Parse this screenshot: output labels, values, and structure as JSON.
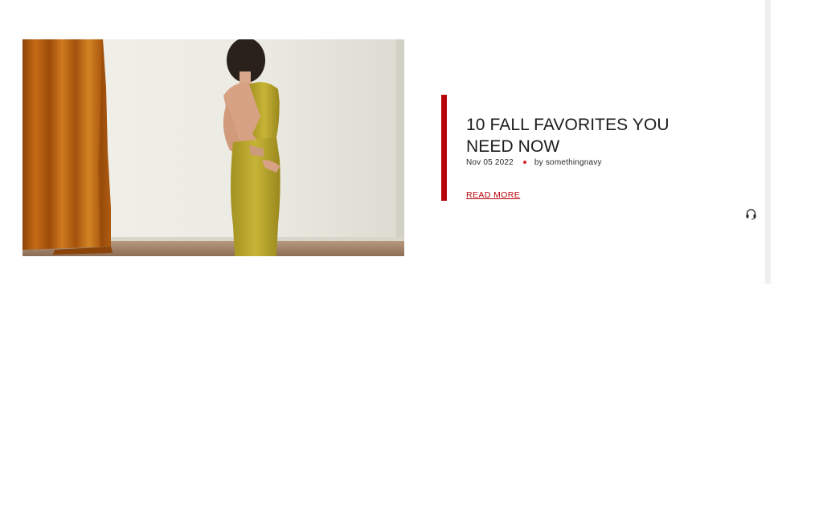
{
  "post": {
    "title": "10 FALL FAVORITES YOU NEED NOW",
    "date": "Nov 05 2022",
    "author": "by somethingnavy",
    "read_more": "READ MORE"
  },
  "hero": {
    "subject": "woman in chartreuse one-shoulder cut-out dress",
    "alt": "10 FALL FAVORITES YOU NEED NOW"
  },
  "support": {
    "icon": "headset-icon"
  },
  "colors": {
    "accent": "#b8050b",
    "title_text": "#1c1c1c",
    "dress": "#b9a62c",
    "curtain": "#b5600f",
    "background": "#ffffff"
  }
}
